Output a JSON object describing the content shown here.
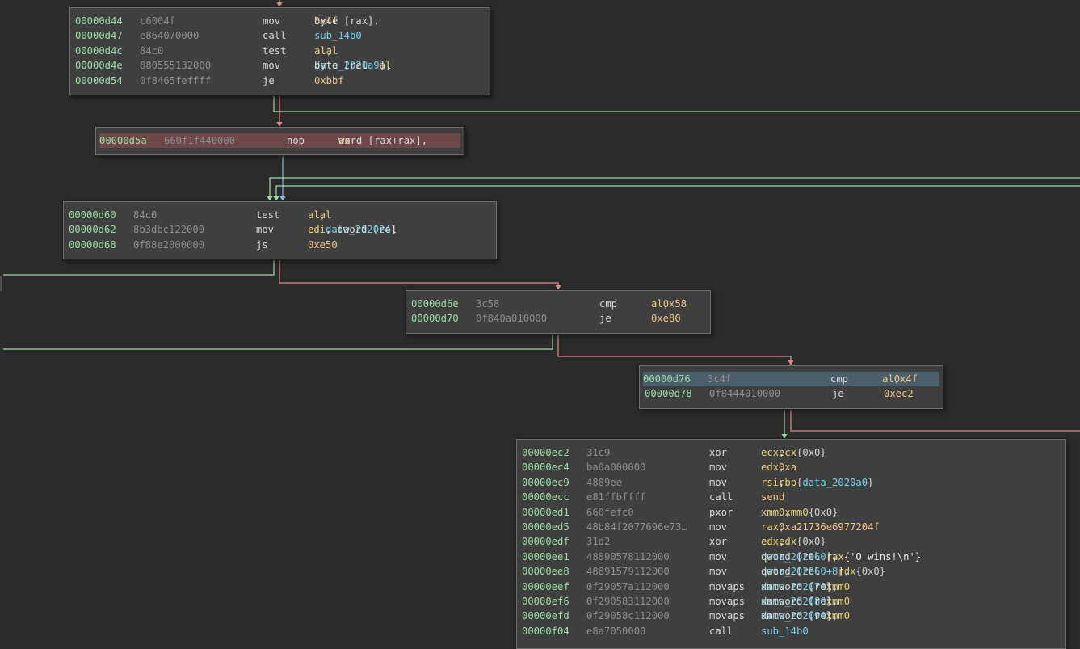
{
  "theme": {
    "background": "#2b2b2b",
    "block_bg": "#3f3f3f",
    "address_color": "#9fdaa6",
    "bytes_color": "#8e8e8e",
    "number_color": "#ecc48a",
    "symbol_color": "#73cfe6",
    "true_edge_color": "#9fdaa6",
    "false_edge_color": "#e08a8a",
    "unconditional_edge_color": "#7fbfe6"
  },
  "blocks": [
    {
      "id": "block-d44",
      "rows": [
        {
          "addr": "00000d44",
          "bytes": "c6004f",
          "mnem": "mov",
          "ops": [
            {
              "t": "byte [rax], "
            },
            {
              "n": "0x4f"
            }
          ]
        },
        {
          "addr": "00000d47",
          "bytes": "e864070000",
          "mnem": "call",
          "ops": [
            {
              "s": "sub_14b0"
            }
          ]
        },
        {
          "addr": "00000d4c",
          "bytes": "84c0",
          "mnem": "test",
          "ops": [
            {
              "y": "al"
            },
            {
              "t": ", "
            },
            {
              "y": "al"
            }
          ]
        },
        {
          "addr": "00000d4e",
          "bytes": "880555132000",
          "mnem": "mov",
          "ops": [
            {
              "t": "byte [rel "
            },
            {
              "s": "data_2020a9"
            },
            {
              "t": "], "
            },
            {
              "y": "al"
            }
          ]
        },
        {
          "addr": "00000d54",
          "bytes": "0f8465feffff",
          "mnem": "je",
          "ops": [
            {
              "n": "0xbbf"
            }
          ]
        }
      ]
    },
    {
      "id": "block-d5a",
      "rows": [
        {
          "addr": "00000d5a",
          "bytes": "660f1f440000",
          "mnem": "nop",
          "hl": "red",
          "ops": [
            {
              "t": "word [rax+rax], "
            },
            {
              "y": "ax"
            }
          ]
        }
      ]
    },
    {
      "id": "block-d60",
      "rows": [
        {
          "addr": "00000d60",
          "bytes": "84c0",
          "mnem": "test",
          "ops": [
            {
              "y": "al"
            },
            {
              "t": ", "
            },
            {
              "y": "al"
            }
          ]
        },
        {
          "addr": "00000d62",
          "bytes": "8b3dbc122000",
          "mnem": "mov",
          "ops": [
            {
              "y": "edi"
            },
            {
              "t": ", dword [rel "
            },
            {
              "s": "data_202024"
            },
            {
              "t": "]"
            }
          ]
        },
        {
          "addr": "00000d68",
          "bytes": "0f88e2000000",
          "mnem": "js",
          "ops": [
            {
              "n": "0xe50"
            }
          ]
        }
      ]
    },
    {
      "id": "block-d6e",
      "rows": [
        {
          "addr": "00000d6e",
          "bytes": "3c58",
          "mnem": "cmp",
          "ops": [
            {
              "y": "al"
            },
            {
              "t": ", "
            },
            {
              "n": "0x58"
            }
          ]
        },
        {
          "addr": "00000d70",
          "bytes": "0f840a010000",
          "mnem": "je",
          "ops": [
            {
              "n": "0xe80"
            }
          ]
        }
      ]
    },
    {
      "id": "block-d76",
      "rows": [
        {
          "addr": "00000d76",
          "bytes": "3c4f",
          "mnem": "cmp",
          "hl": "blue",
          "ops": [
            {
              "y": "al"
            },
            {
              "t": ", "
            },
            {
              "n": "0x4f"
            }
          ]
        },
        {
          "addr": "00000d78",
          "bytes": "0f8444010000",
          "mnem": "je",
          "ops": [
            {
              "n": "0xec2"
            }
          ]
        }
      ]
    },
    {
      "id": "block-ec2",
      "rows": [
        {
          "addr": "00000ec2",
          "bytes": "31c9",
          "mnem": "xor",
          "ops": [
            {
              "y": "ecx"
            },
            {
              "t": ", "
            },
            {
              "y": "ecx"
            },
            {
              "t": "  "
            },
            {
              "c": "{0x0}"
            }
          ]
        },
        {
          "addr": "00000ec4",
          "bytes": "ba0a000000",
          "mnem": "mov",
          "ops": [
            {
              "y": "edx"
            },
            {
              "t": ", "
            },
            {
              "n": "0xa"
            }
          ]
        },
        {
          "addr": "00000ec9",
          "bytes": "4889ee",
          "mnem": "mov",
          "ops": [
            {
              "y": "rsi"
            },
            {
              "t": ", "
            },
            {
              "y": "rbp"
            },
            {
              "t": "  "
            },
            {
              "c": "{"
            },
            {
              "s": "data_2020a0"
            },
            {
              "c": "}"
            }
          ]
        },
        {
          "addr": "00000ecc",
          "bytes": "e81ffbffff",
          "mnem": "call",
          "ops": [
            {
              "n": "send"
            }
          ]
        },
        {
          "addr": "00000ed1",
          "bytes": "660fefc0",
          "mnem": "pxor",
          "ops": [
            {
              "y": "xmm0"
            },
            {
              "t": ", "
            },
            {
              "y": "xmm0"
            },
            {
              "t": "  "
            },
            {
              "c": "{0x0}"
            }
          ]
        },
        {
          "addr": "00000ed5",
          "bytes": "48b84f2077696e73…",
          "mnem": "mov",
          "ops": [
            {
              "y": "rax"
            },
            {
              "t": ", "
            },
            {
              "n": "0xa21736e6977204f"
            }
          ]
        },
        {
          "addr": "00000edf",
          "bytes": "31d2",
          "mnem": "xor",
          "ops": [
            {
              "y": "edx"
            },
            {
              "t": ", "
            },
            {
              "y": "edx"
            },
            {
              "t": "  "
            },
            {
              "c": "{0x0}"
            }
          ]
        },
        {
          "addr": "00000ee1",
          "bytes": "48890578112000",
          "mnem": "mov",
          "ops": [
            {
              "t": "qword [rel "
            },
            {
              "s": "data_202060"
            },
            {
              "t": "], "
            },
            {
              "y": "rax"
            },
            {
              "t": "  "
            },
            {
              "w": "{'O wins!\\n'}"
            }
          ]
        },
        {
          "addr": "00000ee8",
          "bytes": "48891579112000",
          "mnem": "mov",
          "ops": [
            {
              "t": "qword [rel "
            },
            {
              "s": "data_202060+8"
            },
            {
              "t": "], "
            },
            {
              "y": "rdx"
            },
            {
              "t": "  "
            },
            {
              "c": "{0x0}"
            }
          ]
        },
        {
          "addr": "00000eef",
          "bytes": "0f29057a112000",
          "mnem": "movaps",
          "ops": [
            {
              "t": "xmmword [rel "
            },
            {
              "s": "data_202070"
            },
            {
              "t": "], "
            },
            {
              "y": "xmm0"
            }
          ]
        },
        {
          "addr": "00000ef6",
          "bytes": "0f290583112000",
          "mnem": "movaps",
          "ops": [
            {
              "t": "xmmword [rel "
            },
            {
              "s": "data_202080"
            },
            {
              "t": "], "
            },
            {
              "y": "xmm0"
            }
          ]
        },
        {
          "addr": "00000efd",
          "bytes": "0f29058c112000",
          "mnem": "movaps",
          "ops": [
            {
              "t": "xmmword [rel "
            },
            {
              "s": "data_202090"
            },
            {
              "t": "], "
            },
            {
              "y": "xmm0"
            }
          ]
        },
        {
          "addr": "00000f04",
          "bytes": "e8a7050000",
          "mnem": "call",
          "ops": [
            {
              "s": "sub_14b0"
            }
          ]
        }
      ]
    }
  ]
}
